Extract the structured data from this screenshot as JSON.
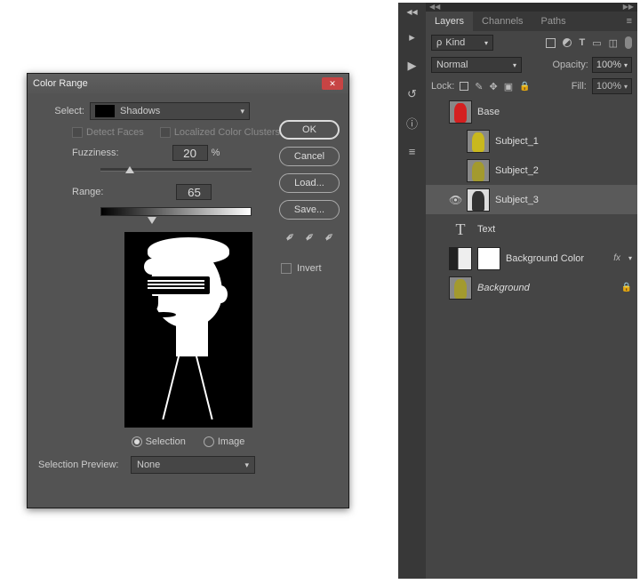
{
  "dialog": {
    "title": "Color Range",
    "select_label": "Select:",
    "select_value": "Shadows",
    "detect_faces": "Detect Faces",
    "localized": "Localized Color Clusters",
    "fuzziness_label": "Fuzziness:",
    "fuzziness_value": "20",
    "percent": "%",
    "range_label": "Range:",
    "range_value": "65",
    "radio_selection": "Selection",
    "radio_image": "Image",
    "sel_preview_label": "Selection Preview:",
    "sel_preview_value": "None",
    "buttons": {
      "ok": "OK",
      "cancel": "Cancel",
      "load": "Load...",
      "save": "Save..."
    },
    "invert_label": "Invert"
  },
  "panel": {
    "tabs": {
      "layers": "Layers",
      "channels": "Channels",
      "paths": "Paths"
    },
    "kind_prefix": "ρ",
    "kind_value": "Kind",
    "T": "T",
    "blend_mode": "Normal",
    "opacity_label": "Opacity:",
    "opacity_value": "100%",
    "lock_label": "Lock:",
    "fill_label": "Fill:",
    "fill_value": "100%",
    "layers": [
      {
        "name": "Base"
      },
      {
        "name": "Subject_1"
      },
      {
        "name": "Subject_2"
      },
      {
        "name": "Subject_3"
      },
      {
        "name": "Text"
      },
      {
        "name": "Background Color",
        "fx": "fx"
      },
      {
        "name": "Background"
      }
    ]
  }
}
